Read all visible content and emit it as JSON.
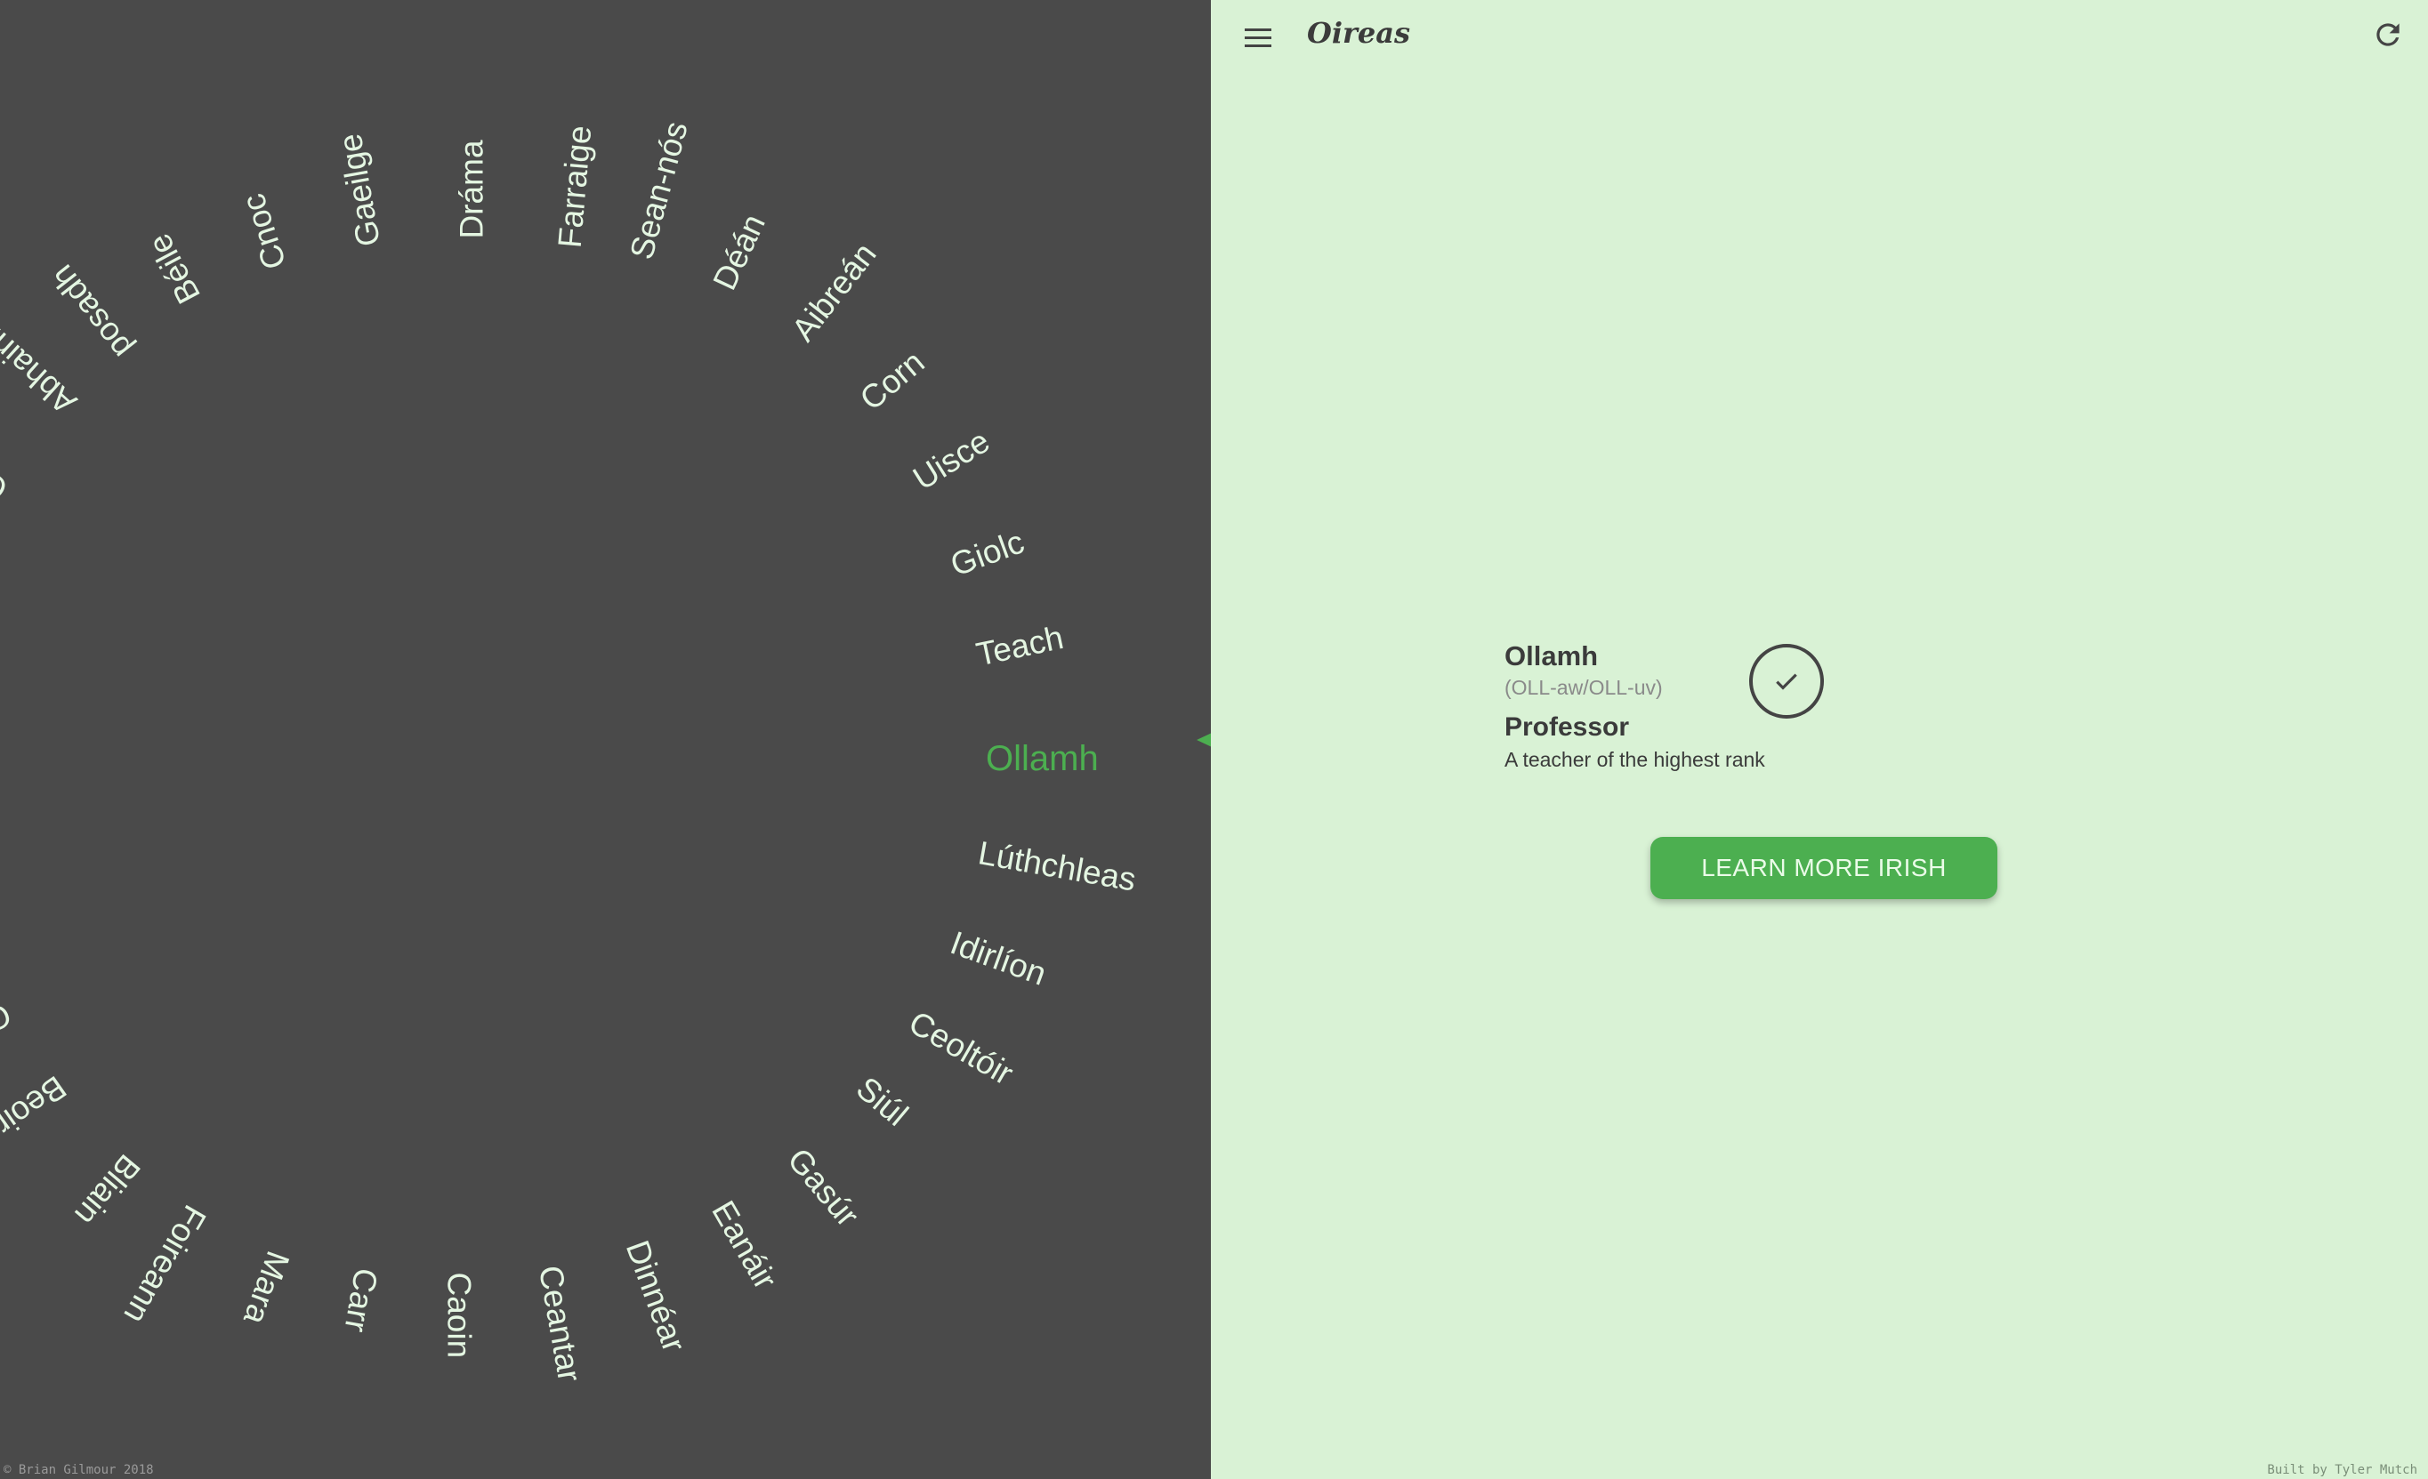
{
  "app": {
    "title": "Oireas"
  },
  "wheel": {
    "words": [
      "Teach",
      "Giolc",
      "Uisce",
      "Corn",
      "Aibreán",
      "Déán",
      "Sean-nós",
      "Farraige",
      "Dráma",
      "Gaeilge",
      "Cnoc",
      "Béile",
      "posadh",
      "Abhainn",
      "Ga",
      "Ollamh",
      "Lúthchleas",
      "Idirlíon",
      "Ceoltóir",
      "Siúl",
      "Gasúr",
      "Eanáir",
      "Dinnéar",
      "Ceantar",
      "Caoin",
      "Carr",
      "Mara",
      "Foireann",
      "Bliain",
      "Beoir",
      "G"
    ],
    "active": "Ollamh"
  },
  "card": {
    "word": "Ollamh",
    "pronunciation": "(OLL-aw/OLL-uv)",
    "translation": "Professor",
    "definition": "A teacher of the highest rank"
  },
  "actions": {
    "learn_more": "LEARN MORE IRISH"
  },
  "footer": {
    "copyright": "© Brian Gilmour 2018",
    "credit": "Built by Tyler Mutch"
  },
  "colors": {
    "accent": "#4caf50",
    "dark_panel": "#4a4a4a",
    "light_panel": "#d9f2d5"
  },
  "icons": {
    "menu": "menu-icon",
    "refresh": "refresh-icon",
    "check": "check-icon",
    "pointer": "pointer-arrow-icon"
  }
}
